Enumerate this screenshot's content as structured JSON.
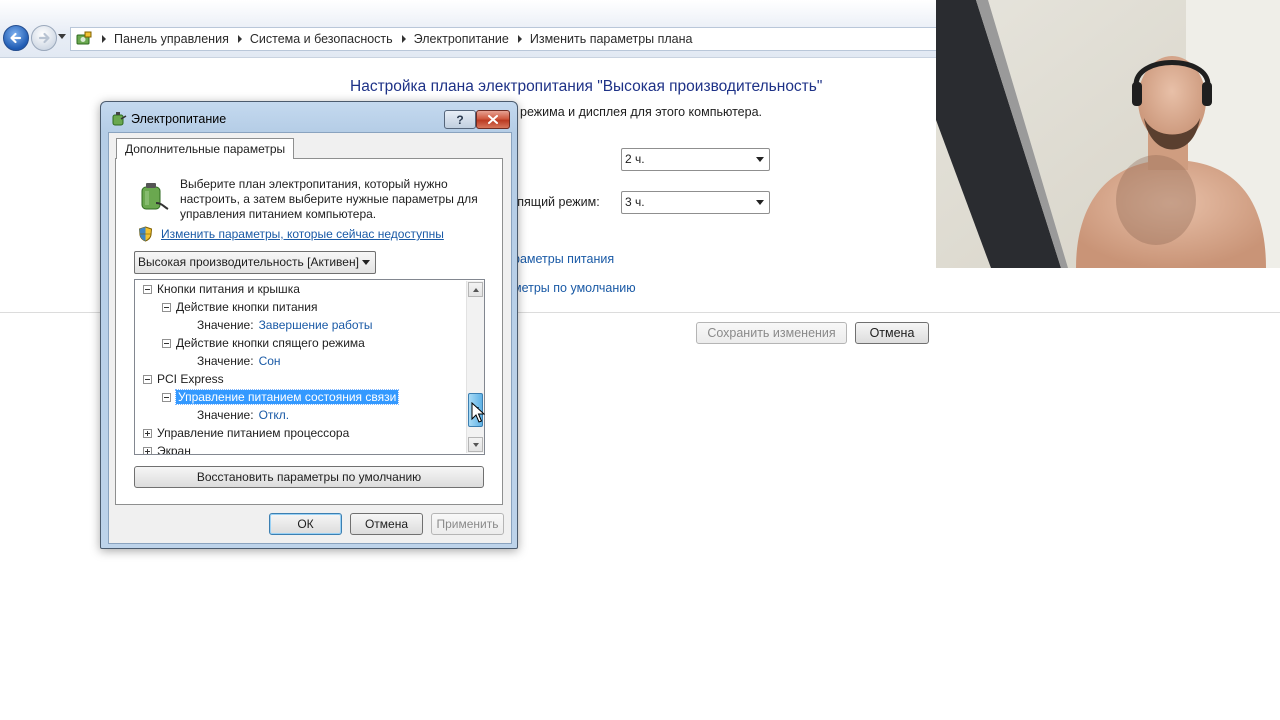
{
  "explorer": {
    "breadcrumbs": [
      "Панель управления",
      "Система и безопасность",
      "Электропитание",
      "Изменить параметры плана"
    ]
  },
  "page": {
    "title": "Настройка плана электропитания \"Высокая производительность\"",
    "subtitle": "режима и дисплея для этого компьютера.",
    "display_off_value": "2 ч.",
    "sleep_label": "спящий режим:",
    "sleep_value": "3 ч.",
    "link_advanced": "раметры питания",
    "link_restore": "метры по умолчанию",
    "save_button": "Сохранить изменения",
    "cancel_button": "Отмена"
  },
  "dialog": {
    "title": "Электропитание",
    "help_symbol": "?",
    "tab": "Дополнительные параметры",
    "intro": "Выберите план электропитания, который нужно настроить, а затем выберите нужные параметры для управления питанием компьютера.",
    "unavailable_link": "Изменить параметры, которые сейчас недоступны",
    "plan_selected": "Высокая производительность [Активен]",
    "tree": {
      "value_label": "Значение:",
      "power_buttons_group": "Кнопки питания и крышка",
      "power_button_action": "Действие кнопки питания",
      "power_button_value": "Завершение работы",
      "sleep_button_action": "Действие кнопки спящего режима",
      "sleep_button_value": "Сон",
      "pci_group": "PCI Express",
      "link_state": "Управление питанием состояния связи",
      "link_state_value": "Откл.",
      "processor_group": "Управление питанием процессора",
      "display_group": "Экран"
    },
    "restore_button": "Восстановить параметры по умолчанию",
    "ok_button": "ОК",
    "cancel_button": "Отмена",
    "apply_button": "Применить"
  },
  "colors": {
    "link": "#1a5aa6",
    "title_blue": "#1e3287",
    "selection": "#3399ff"
  },
  "icons": [
    "back-arrow-icon",
    "forward-arrow-icon",
    "control-panel-icon",
    "battery-plug-icon",
    "uac-shield-icon",
    "close-icon",
    "mouse-cursor-icon"
  ]
}
